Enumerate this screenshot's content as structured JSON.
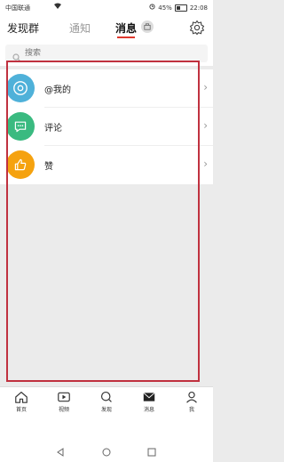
{
  "status_bar": {
    "carrier": "中国联通",
    "battery_percent": "45%",
    "time": "22:08"
  },
  "header": {
    "tabs": [
      {
        "label": "发现群"
      },
      {
        "label": "通知"
      },
      {
        "label": "消息"
      }
    ],
    "active_tab": "消息"
  },
  "search": {
    "placeholder": "搜索"
  },
  "messages": {
    "items": [
      {
        "label": "@我的",
        "icon": "at-icon",
        "color": "#4fb1d9"
      },
      {
        "label": "评论",
        "icon": "comment-icon",
        "color": "#3aba80"
      },
      {
        "label": "赞",
        "icon": "thumbs-up-icon",
        "color": "#f5a20f"
      }
    ]
  },
  "bottom_nav": {
    "items": [
      {
        "label": "首页",
        "icon": "home-icon"
      },
      {
        "label": "视频",
        "icon": "video-icon"
      },
      {
        "label": "发现",
        "icon": "discover-icon"
      },
      {
        "label": "消息",
        "icon": "message-icon"
      },
      {
        "label": "我",
        "icon": "profile-icon"
      }
    ]
  },
  "colors": {
    "accent": "#e0382d",
    "highlight_frame": "#c0313f"
  }
}
